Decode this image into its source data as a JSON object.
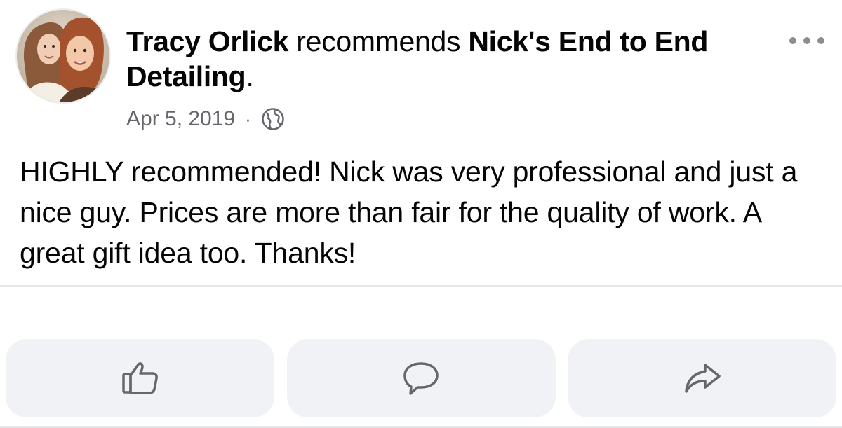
{
  "post": {
    "author_name": "Tracy Orlick",
    "action_text": " recommends ",
    "page_name": "Nick's End to End Detailing",
    "period": ".",
    "date": "Apr 5, 2019",
    "separator": "·",
    "privacy_icon": "globe-icon",
    "body": "HIGHLY recommended! Nick was very professional and just a nice guy. Prices are more than fair for the quality of work. A great gift idea too. Thanks!"
  },
  "menu": {
    "icon": "more-options-icon"
  },
  "actions": [
    {
      "icon": "thumbs-up-icon"
    },
    {
      "icon": "comment-icon"
    },
    {
      "icon": "share-icon"
    }
  ],
  "colors": {
    "text_primary": "#050505",
    "text_secondary": "#65676b",
    "button_bg": "#f0f2f5",
    "divider": "#e4e6e9"
  }
}
